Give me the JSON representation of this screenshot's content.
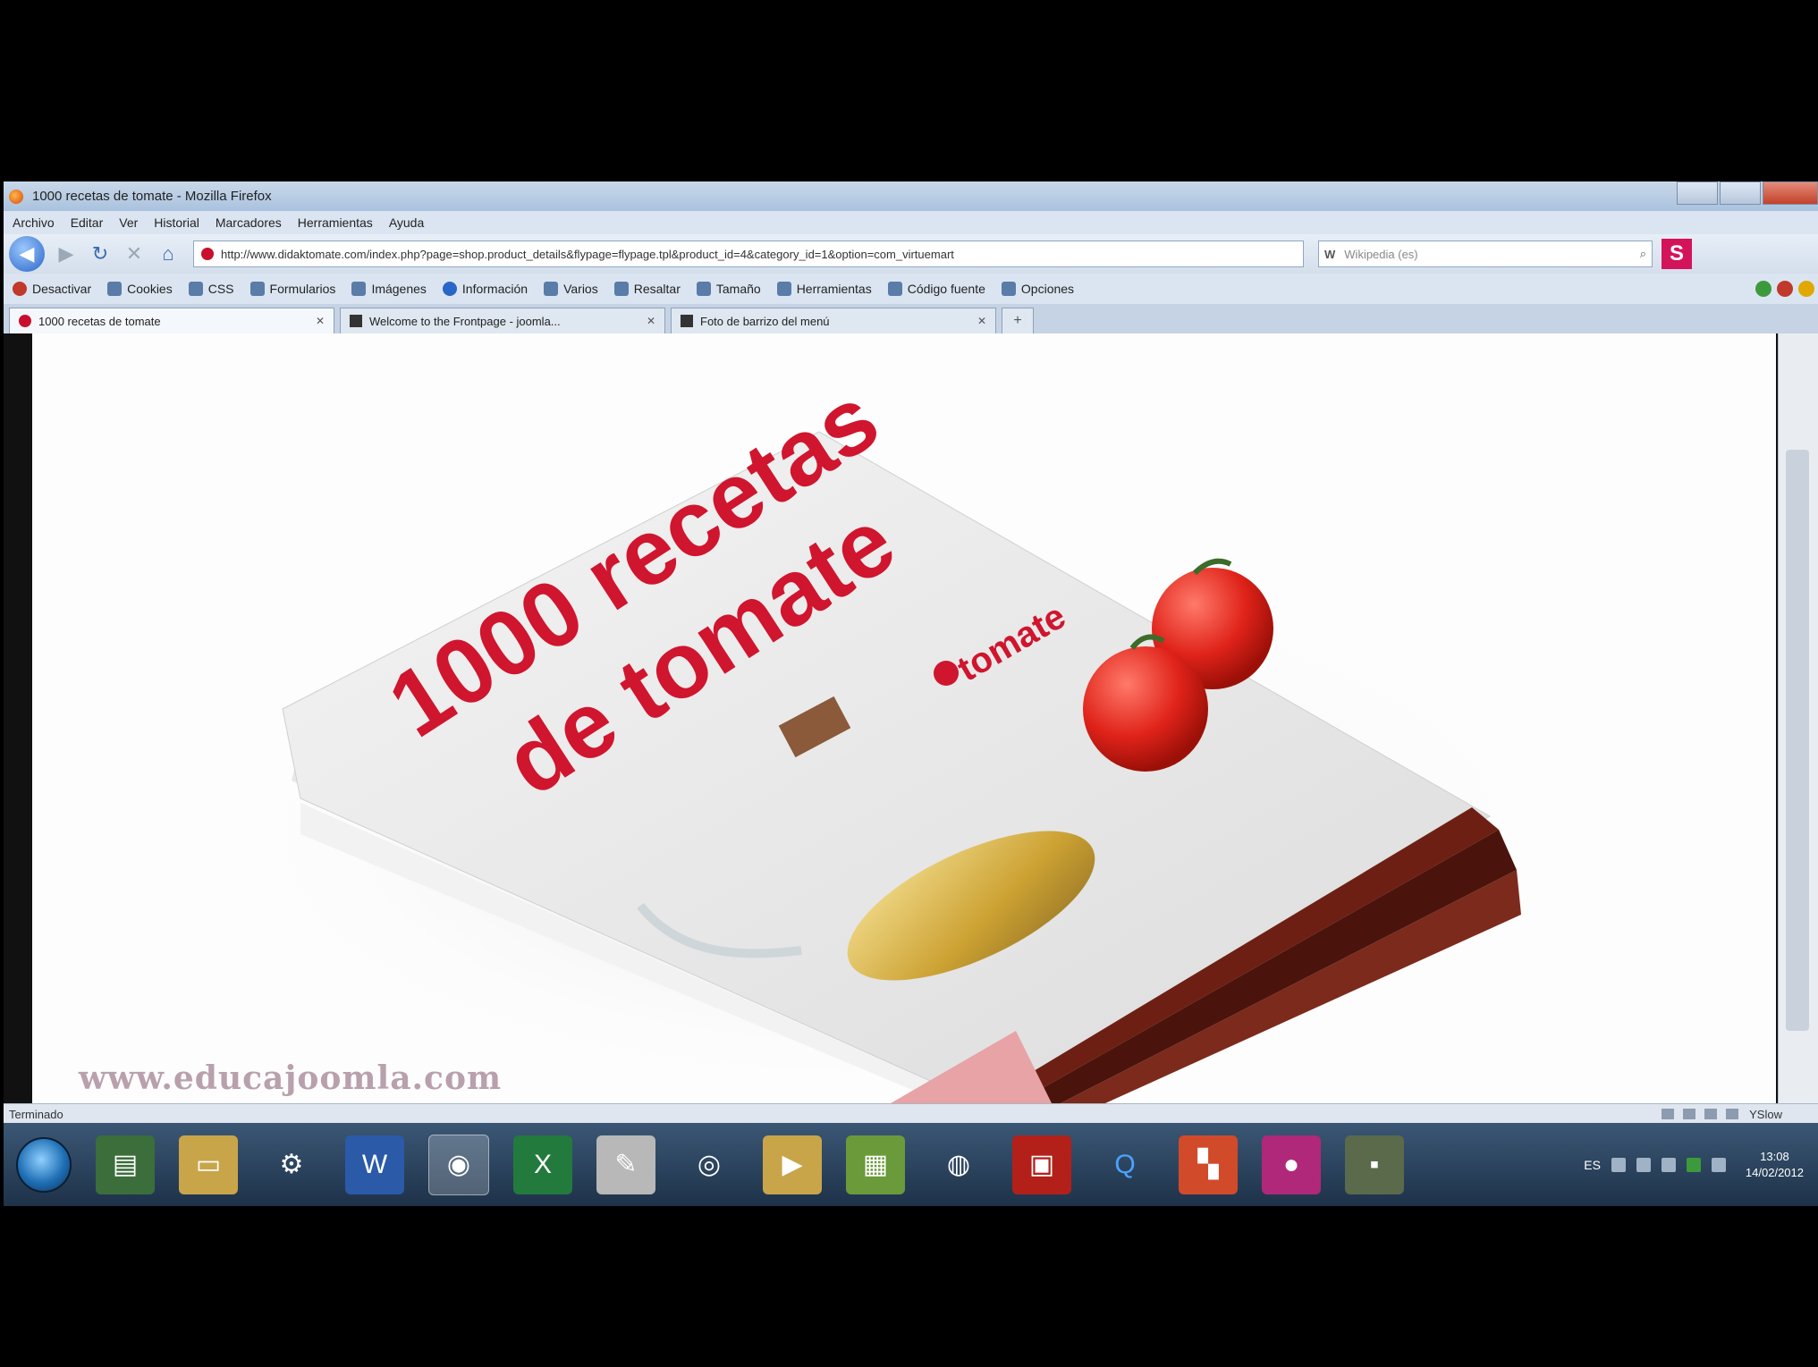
{
  "window": {
    "title": "1000 recetas de tomate - Mozilla Firefox"
  },
  "menu": [
    "Archivo",
    "Editar",
    "Ver",
    "Historial",
    "Marcadores",
    "Herramientas",
    "Ayuda"
  ],
  "nav": {
    "url": "http://www.didaktomate.com/index.php?page=shop.product_details&flypage=flypage.tpl&product_id=4&category_id=1&option=com_virtuemart",
    "search_engine": "W",
    "search_placeholder": "Wikipedia (es)"
  },
  "devtoolbar": [
    "Desactivar",
    "Cookies",
    "CSS",
    "Formularios",
    "Imágenes",
    "Información",
    "Varios",
    "Resaltar",
    "Tamaño",
    "Herramientas",
    "Código fuente",
    "Opciones"
  ],
  "tabs": [
    {
      "label": "1000 recetas de tomate",
      "active": true
    },
    {
      "label": "Welcome to the Frontpage - joomla...",
      "active": false
    },
    {
      "label": "Foto de barrizo del menú",
      "active": false
    }
  ],
  "content": {
    "book_title_line1": "1000 recetas",
    "book_title_line2": "de tomate",
    "brand": "tomate",
    "watermark": "www.educajoomla.com"
  },
  "status": {
    "text": "Terminado",
    "yslow": "YSlow"
  },
  "taskbar": {
    "apps": [
      "programs-icon",
      "explorer-icon",
      "network-icon",
      "word-icon",
      "firefox-icon",
      "excel-icon",
      "paint-icon",
      "chrome-icon",
      "media-icon",
      "notes-icon",
      "browser-icon",
      "pdf-icon",
      "quicktime-icon",
      "office-icon",
      "skype-icon",
      "camtasia-icon"
    ],
    "lang": "ES",
    "time": "13:08",
    "date": "14/02/2012"
  }
}
